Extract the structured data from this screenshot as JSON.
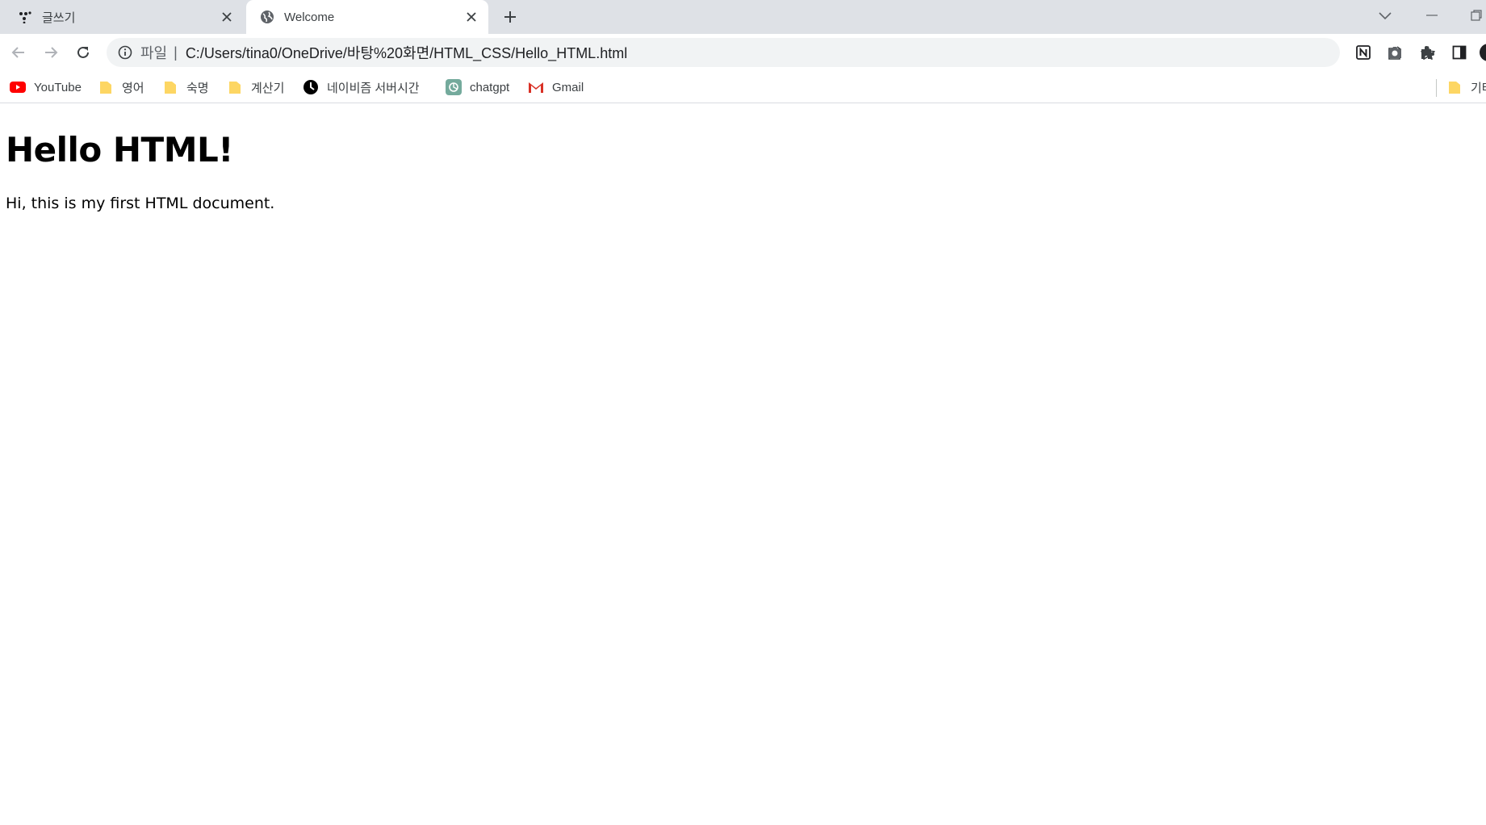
{
  "tabs": [
    {
      "title": "글쓰기",
      "icon": "app-dots-icon",
      "active": false
    },
    {
      "title": "Welcome",
      "icon": "globe-icon",
      "active": true
    }
  ],
  "omnibox": {
    "scheme_label": "파일",
    "separator": "|",
    "url": "C:/Users/tina0/OneDrive/바탕%20화면/HTML_CSS/Hello_HTML.html"
  },
  "bookmarks": [
    {
      "label": "YouTube",
      "icon": "youtube-icon"
    },
    {
      "label": "영어",
      "icon": "folder-icon"
    },
    {
      "label": "숙명",
      "icon": "folder-icon"
    },
    {
      "label": "계산기",
      "icon": "folder-icon"
    },
    {
      "label": "네이비즘 서버시간",
      "icon": "clock-icon"
    },
    {
      "label": "chatgpt",
      "icon": "chatgpt-icon"
    },
    {
      "label": "Gmail",
      "icon": "gmail-icon"
    },
    {
      "label": "기타",
      "icon": "folder-icon"
    }
  ],
  "page": {
    "heading": "Hello HTML!",
    "paragraph": "Hi, this is my first HTML document."
  },
  "colors": {
    "tabstrip_bg": "#dee1e6",
    "omnibox_bg": "#f1f3f4",
    "folder_yellow": "#fdd663",
    "youtube_red": "#ff0000"
  }
}
